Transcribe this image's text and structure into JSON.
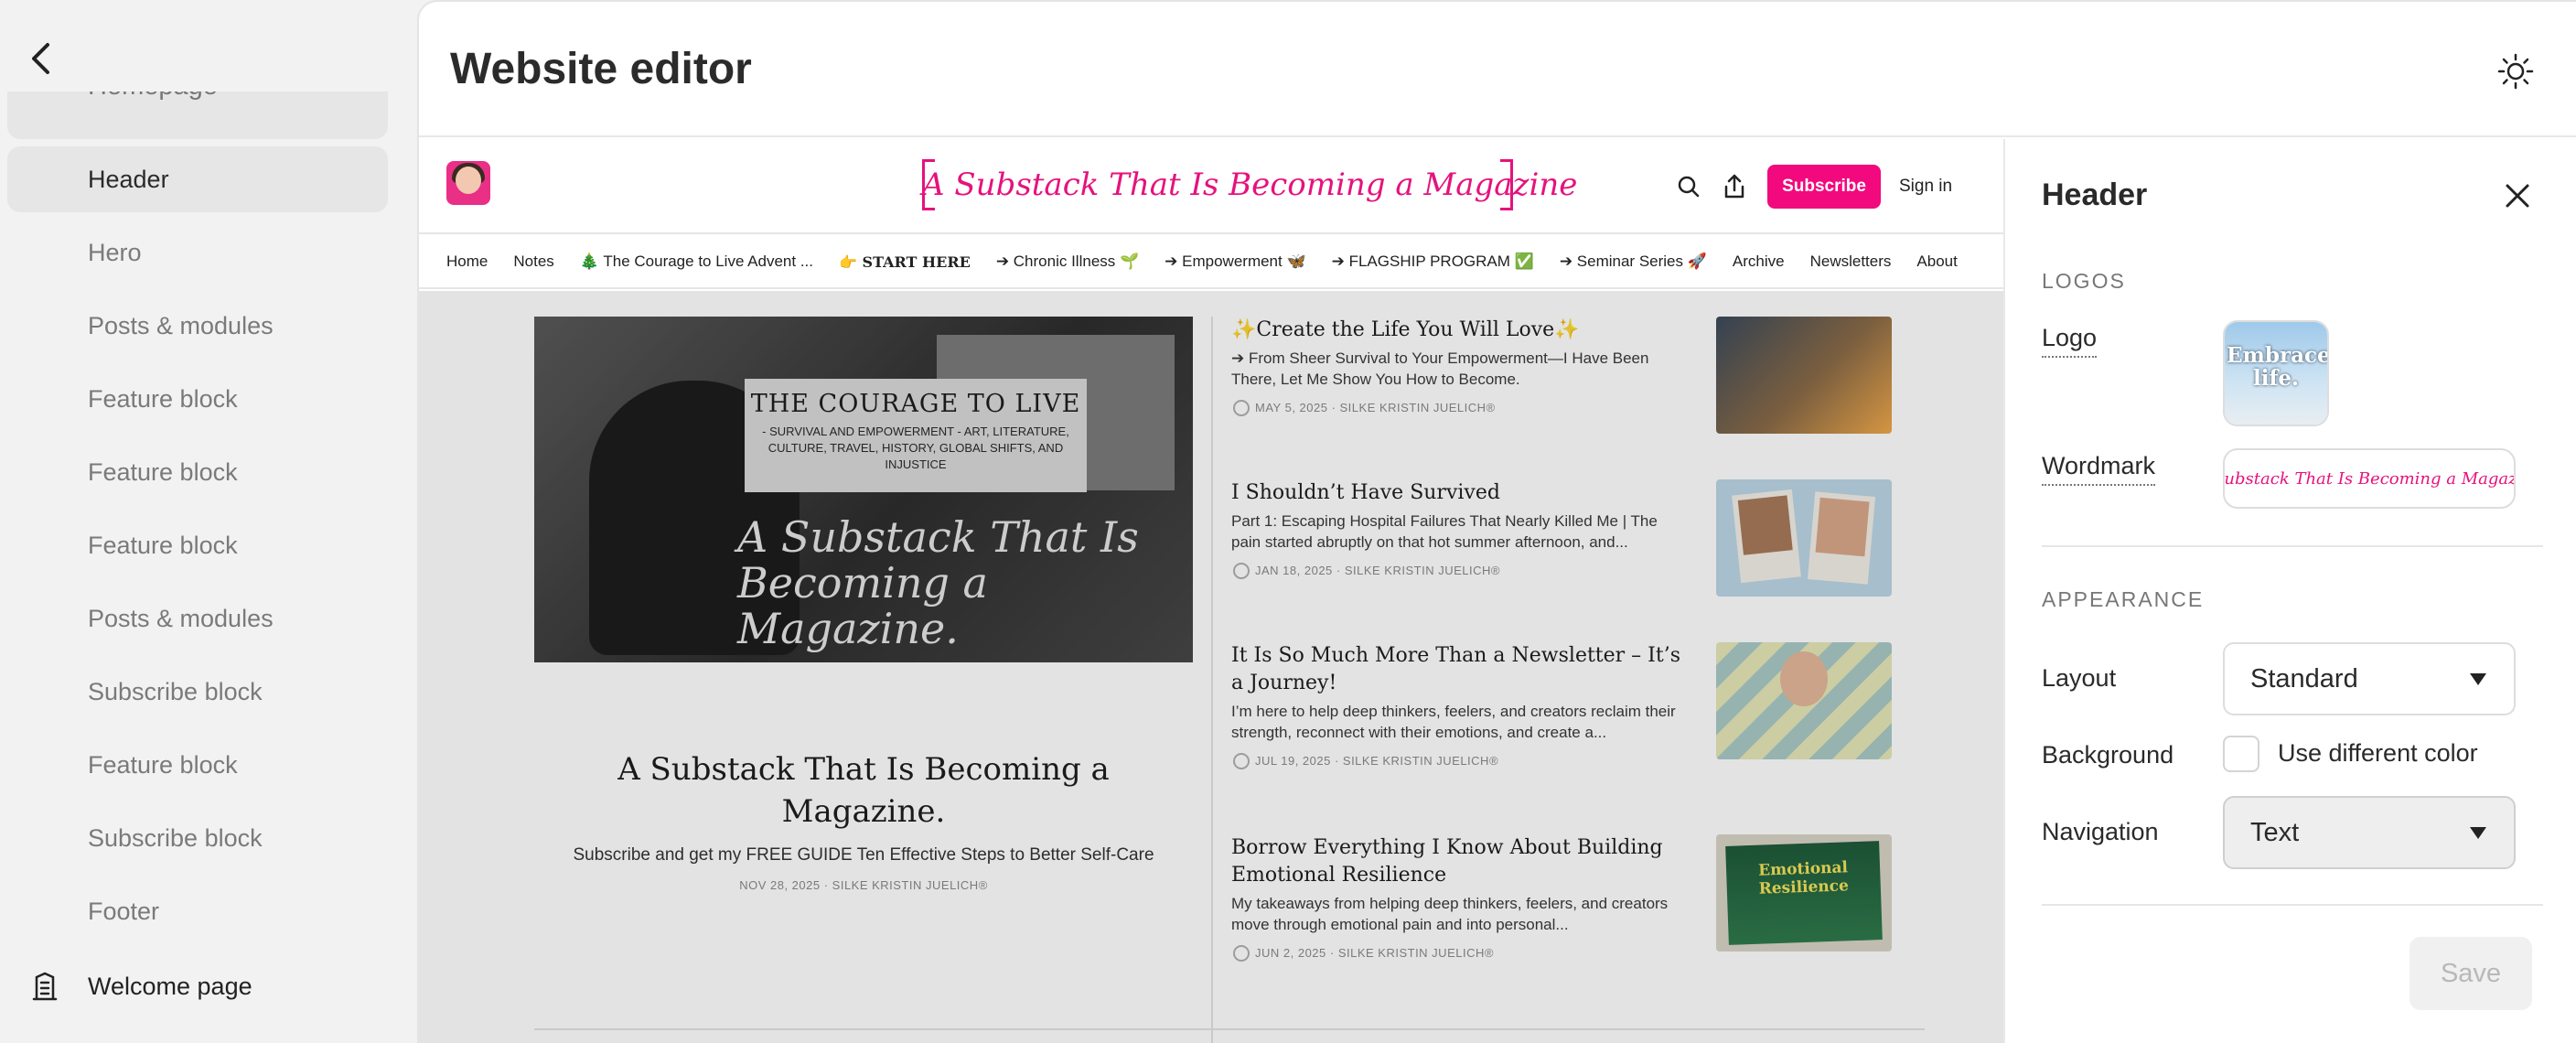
{
  "sidebar": {
    "partial_item": "Homepage",
    "items": [
      {
        "label": "Header",
        "active": true
      },
      {
        "label": "Hero"
      },
      {
        "label": "Posts & modules"
      },
      {
        "label": "Feature block"
      },
      {
        "label": "Feature block"
      },
      {
        "label": "Feature block"
      },
      {
        "label": "Posts & modules"
      },
      {
        "label": "Subscribe block"
      },
      {
        "label": "Feature block"
      },
      {
        "label": "Subscribe block"
      },
      {
        "label": "Footer"
      }
    ],
    "welcome": "Welcome page"
  },
  "topbar": {
    "title": "Website editor"
  },
  "preview": {
    "wordmark": "A Substack That Is Becoming a Magazine",
    "subscribe_label": "Subscribe",
    "signin_label": "Sign in",
    "nav": [
      "Home",
      "Notes",
      "🎄 The Courage to Live Advent ...",
      "👉 START HERE",
      "➔ Chronic Illness 🌱",
      "➔ Empowerment 🦋",
      "➔ FLAGSHIP PROGRAM ✅",
      "➔ Seminar Series 🚀",
      "Archive",
      "Newsletters",
      "About"
    ],
    "hero_card_title": "THE COURAGE TO LIVE",
    "hero_card_sub": "- SURVIVAL AND EMPOWERMENT - ART, LITERATURE, CULTURE, TRAVEL, HISTORY, GLOBAL SHIFTS, AND INJUSTICE",
    "hero_script": "A Substack That Is Becoming a Magazine.",
    "hero_title": "A Substack That Is Becoming a Magazine.",
    "hero_subtitle": "Subscribe and get my FREE GUIDE Ten Effective Steps to Better Self-Care",
    "hero_meta": "NOV 28, 2025 · SILKE KRISTIN JUELICH®",
    "posts": [
      {
        "title": "✨Create the Life You Will Love✨",
        "desc": "➔ From Sheer Survival to Your Empowerment—I Have Been There, Let Me Show You How to Become.",
        "meta": "MAY 5, 2025 · SILKE KRISTIN JUELICH®"
      },
      {
        "title": "I Shouldn’t Have Survived",
        "desc": "Part 1: Escaping Hospital Failures That Nearly Killed Me | The pain started abruptly on that hot summer afternoon, and...",
        "meta": "JAN 18, 2025 · SILKE KRISTIN JUELICH®"
      },
      {
        "title": "It Is So Much More Than a Newsletter – It’s a Journey!",
        "desc": "I’m here to help deep thinkers, feelers, and creators reclaim their strength, reconnect with their emotions, and create a...",
        "meta": "JUL 19, 2025 · SILKE KRISTIN JUELICH®"
      },
      {
        "title": "Borrow Everything I Know About Building Emotional Resilience",
        "desc": "My takeaways from helping deep thinkers, feelers, and creators move through emotional pain and into personal...",
        "meta": "JUN 2, 2025 · SILKE KRISTIN JUELICH®"
      }
    ],
    "thumb4_text": "Emotional Resilience"
  },
  "settings": {
    "title": "Header",
    "logos_section": "LOGOS",
    "logo_label": "Logo",
    "logo_image_text": "Embrace life.",
    "wordmark_label": "Wordmark",
    "wordmark_preview": "A Substack That Is Becoming a Magazine",
    "appearance_section": "APPEARANCE",
    "layout_label": "Layout",
    "layout_value": "Standard",
    "background_label": "Background",
    "background_checkbox": "Use different color",
    "navigation_label": "Navigation",
    "navigation_value": "Text",
    "save_label": "Save"
  },
  "colors": {
    "accent": "#f2097e",
    "wordmark": "#e6127d"
  }
}
